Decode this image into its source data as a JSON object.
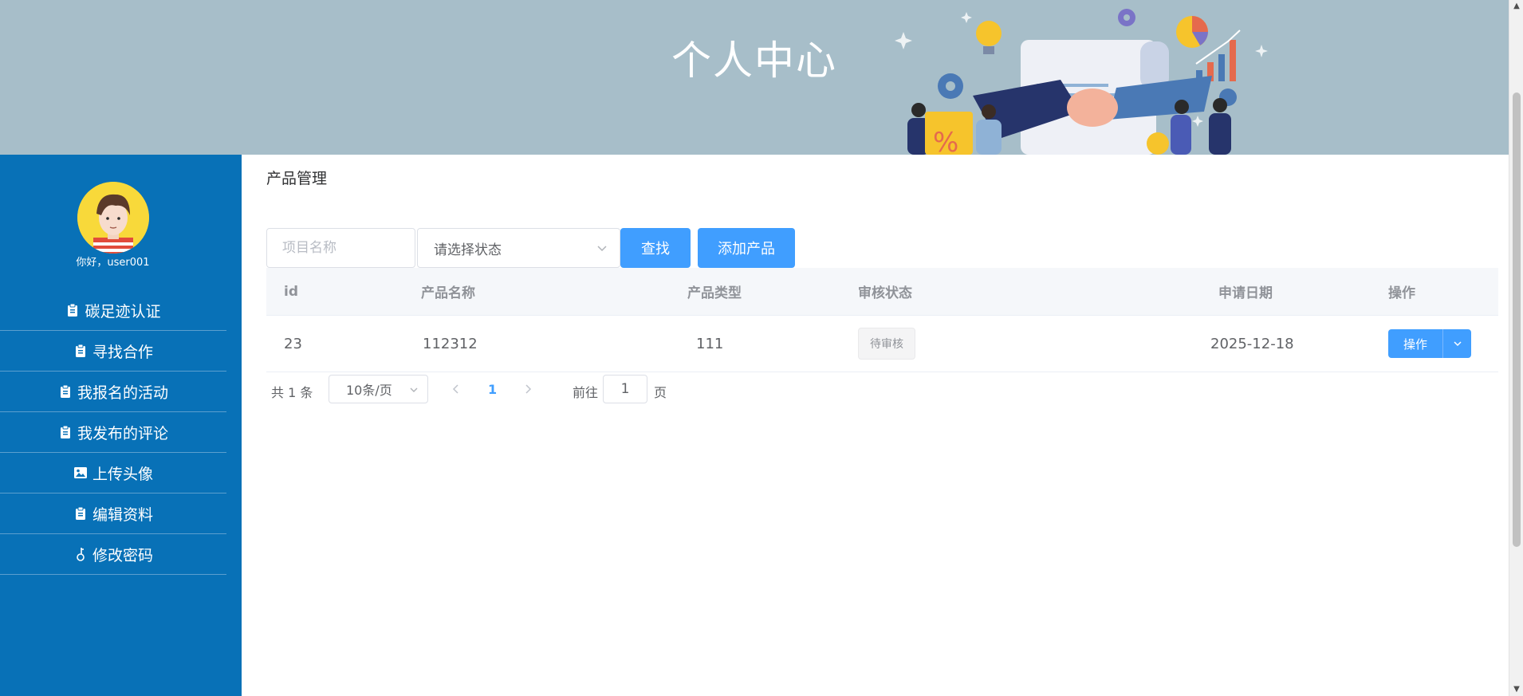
{
  "banner": {
    "title": "个人中心"
  },
  "sidebar": {
    "greeting": "你好，user001",
    "items": [
      {
        "label": "碳足迹认证",
        "icon": "clipboard-icon"
      },
      {
        "label": "寻找合作",
        "icon": "clipboard-icon"
      },
      {
        "label": "我报名的活动",
        "icon": "clipboard-icon"
      },
      {
        "label": "我发布的评论",
        "icon": "clipboard-icon"
      },
      {
        "label": "上传头像",
        "icon": "image-icon"
      },
      {
        "label": "编辑资料",
        "icon": "clipboard-icon"
      },
      {
        "label": "修改密码",
        "icon": "key-icon"
      }
    ]
  },
  "main": {
    "title": "产品管理",
    "search": {
      "name_placeholder": "项目名称",
      "status_value": "请选择状态",
      "search_label": "查找",
      "add_label": "添加产品"
    },
    "table": {
      "headers": {
        "id": "id",
        "name": "产品名称",
        "type": "产品类型",
        "status": "审核状态",
        "date": "申请日期",
        "op": "操作"
      },
      "rows": [
        {
          "id": "23",
          "name": "112312",
          "type": "111",
          "status": "待审核",
          "date": "2025-12-18",
          "op": "操作"
        }
      ]
    },
    "pagination": {
      "total": "共 1 条",
      "page_size": "10条/页",
      "current": "1",
      "goto_label": "前往",
      "goto_value": "1",
      "unit": "页"
    }
  },
  "colors": {
    "banner_bg": "#a7bec9",
    "sidebar_bg": "#0871b7",
    "primary": "#409eff"
  }
}
